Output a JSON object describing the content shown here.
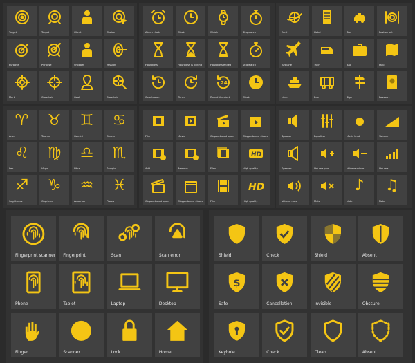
{
  "accent_color": "#f4c514",
  "tile_color": "#414141",
  "background_color": "#2b2b2b",
  "panels": [
    {
      "name": "targets",
      "items": [
        {
          "label": "Target",
          "icon": "target"
        },
        {
          "label": "Target",
          "icon": "target-stand"
        },
        {
          "label": "Client",
          "icon": "client-target"
        },
        {
          "label": "Choice",
          "icon": "target-cursor"
        },
        {
          "label": "Purpose",
          "icon": "target-arrow"
        },
        {
          "label": "Purpose",
          "icon": "target-arrow-stand"
        },
        {
          "label": "Shopper",
          "icon": "shopper-target"
        },
        {
          "label": "Mission",
          "icon": "target-side-arrow"
        },
        {
          "label": "Mark",
          "icon": "crosshair-target"
        },
        {
          "label": "Crosshair",
          "icon": "crosshair"
        },
        {
          "label": "Goal",
          "icon": "map-pin-crosshair"
        },
        {
          "label": "Crosshair",
          "icon": "magnifier-crosshair"
        }
      ]
    },
    {
      "name": "time",
      "items": [
        {
          "label": "Alarm clock",
          "icon": "alarm-clock"
        },
        {
          "label": "Clock",
          "icon": "clock"
        },
        {
          "label": "Watch",
          "icon": "watch"
        },
        {
          "label": "Stopwatch",
          "icon": "stopwatch"
        },
        {
          "label": "Hourglass",
          "icon": "hourglass"
        },
        {
          "label": "Hourglass is ticking",
          "icon": "hourglass-ticking"
        },
        {
          "label": "Hourglass ended",
          "icon": "hourglass-ended"
        },
        {
          "label": "Stopwatch",
          "icon": "stopwatch-dial"
        },
        {
          "label": "Countdown",
          "icon": "countdown"
        },
        {
          "label": "Timer",
          "icon": "timer"
        },
        {
          "label": "Round the clock",
          "icon": "round-the-clock"
        },
        {
          "label": "Clock",
          "icon": "clock-filled"
        }
      ]
    },
    {
      "name": "travel",
      "items": [
        {
          "label": "Earth",
          "icon": "earth"
        },
        {
          "label": "Hotel",
          "icon": "hotel"
        },
        {
          "label": "Taxi",
          "icon": "taxi"
        },
        {
          "label": "Restaurant",
          "icon": "restaurant"
        },
        {
          "label": "Airplane",
          "icon": "airplane"
        },
        {
          "label": "Train",
          "icon": "train"
        },
        {
          "label": "Bag",
          "icon": "suitcase"
        },
        {
          "label": "Map",
          "icon": "map"
        },
        {
          "label": "Liner",
          "icon": "ship"
        },
        {
          "label": "Bus",
          "icon": "bus"
        },
        {
          "label": "Sign",
          "icon": "signpost"
        },
        {
          "label": "Passport",
          "icon": "passport"
        }
      ]
    },
    {
      "name": "zodiac",
      "items": [
        {
          "label": "Aries",
          "icon": "aries"
        },
        {
          "label": "Taurus",
          "icon": "taurus"
        },
        {
          "label": "Gemini",
          "icon": "gemini"
        },
        {
          "label": "Cancer",
          "icon": "cancer"
        },
        {
          "label": "Leo",
          "icon": "leo"
        },
        {
          "label": "Virgo",
          "icon": "virgo"
        },
        {
          "label": "Libra",
          "icon": "libra"
        },
        {
          "label": "Scorpio",
          "icon": "scorpio"
        },
        {
          "label": "Sagittarius",
          "icon": "sagittarius"
        },
        {
          "label": "Capricorn",
          "icon": "capricorn"
        },
        {
          "label": "Aquarius",
          "icon": "aquarius"
        },
        {
          "label": "Pisces",
          "icon": "pisces"
        }
      ]
    },
    {
      "name": "film",
      "items": [
        {
          "label": "Film",
          "icon": "film"
        },
        {
          "label": "Movie",
          "icon": "movie"
        },
        {
          "label": "Clapperboard open",
          "icon": "clapperboard-open"
        },
        {
          "label": "Clapperboard closed",
          "icon": "clapperboard-closed"
        },
        {
          "label": "Add",
          "icon": "film-add"
        },
        {
          "label": "Remove",
          "icon": "film-remove"
        },
        {
          "label": "Films",
          "icon": "films"
        },
        {
          "label": "High quality",
          "icon": "hd-badge"
        },
        {
          "label": "Clapperboard open",
          "icon": "clapperboard-open-outline"
        },
        {
          "label": "Clapperboard closed",
          "icon": "clapperboard-closed-outline"
        },
        {
          "label": "Film",
          "icon": "film-strip"
        },
        {
          "label": "High quality",
          "icon": "hd-text"
        }
      ]
    },
    {
      "name": "audio",
      "items": [
        {
          "label": "Speaker",
          "icon": "speaker"
        },
        {
          "label": "Equalizer",
          "icon": "equalizer"
        },
        {
          "label": "Music knob",
          "icon": "music-knob"
        },
        {
          "label": "Volume",
          "icon": "volume-triangle"
        },
        {
          "label": "Speaker",
          "icon": "speaker-outline"
        },
        {
          "label": "Volume plus",
          "icon": "volume-plus"
        },
        {
          "label": "Volume minus",
          "icon": "volume-minus"
        },
        {
          "label": "Volume",
          "icon": "volume-bars"
        },
        {
          "label": "Volume max",
          "icon": "volume-max"
        },
        {
          "label": "Mute",
          "icon": "mute"
        },
        {
          "label": "Note",
          "icon": "music-note"
        },
        {
          "label": "Note",
          "icon": "music-notes"
        }
      ]
    },
    {
      "name": "fingerprint",
      "items": [
        {
          "label": "Fingerprint scanner",
          "icon": "fingerprint-scanner"
        },
        {
          "label": "Fingerprint",
          "icon": "fingerprint"
        },
        {
          "label": "Scan",
          "icon": "fingerprint-scan"
        },
        {
          "label": "Scan error",
          "icon": "fingerprint-error"
        },
        {
          "label": "Phone",
          "icon": "phone-fingerprint"
        },
        {
          "label": "Tablet",
          "icon": "tablet-fingerprint"
        },
        {
          "label": "Laptop",
          "icon": "laptop-fingerprint"
        },
        {
          "label": "Desktop",
          "icon": "desktop-fingerprint"
        },
        {
          "label": "Finger",
          "icon": "hand"
        },
        {
          "label": "Scanner",
          "icon": "fingerprint-circle"
        },
        {
          "label": "Lock",
          "icon": "padlock-fingerprint"
        },
        {
          "label": "Home",
          "icon": "home-fingerprint"
        }
      ]
    },
    {
      "name": "shield",
      "items": [
        {
          "label": "Shield",
          "icon": "shield"
        },
        {
          "label": "Check",
          "icon": "shield-check"
        },
        {
          "label": "Shield",
          "icon": "shield-quartered"
        },
        {
          "label": "Absent",
          "icon": "shield-half"
        },
        {
          "label": "Safe",
          "icon": "shield-dollar"
        },
        {
          "label": "Cancellation",
          "icon": "shield-x"
        },
        {
          "label": "Invisible",
          "icon": "shield-striped"
        },
        {
          "label": "Obscure",
          "icon": "shield-bars"
        },
        {
          "label": "Keyhole",
          "icon": "shield-keyhole"
        },
        {
          "label": "Check",
          "icon": "shield-check-outline"
        },
        {
          "label": "Clean",
          "icon": "shield-outline"
        },
        {
          "label": "Absent",
          "icon": "shield-dashed"
        }
      ]
    }
  ]
}
